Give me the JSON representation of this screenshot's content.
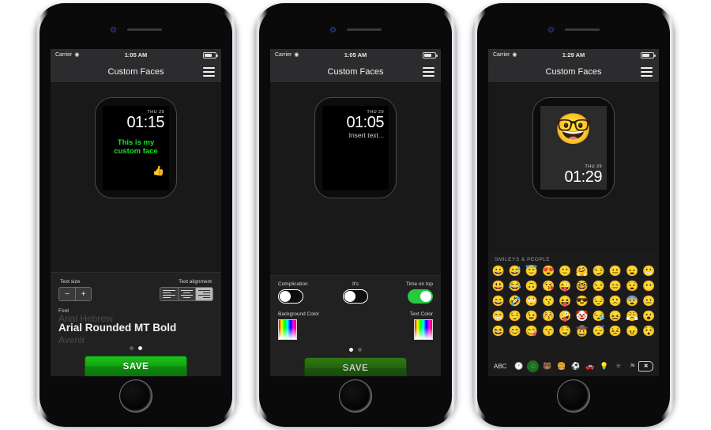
{
  "app": {
    "title": "Custom Faces"
  },
  "phones": [
    {
      "id": "phone-1",
      "status": {
        "carrier": "Carrier",
        "wifi_icon": "wifi-icon",
        "time": "1:05 AM",
        "battery_icon": "battery-icon"
      },
      "nav": {
        "title": "Custom Faces",
        "menu_icon": "hamburger-icon"
      },
      "watch": {
        "date": "THU 29",
        "time": "01:15",
        "custom_text": "This is my\ncustom face",
        "custom_text_line1": "This is my",
        "custom_text_line2": "custom face",
        "text_color": "#17e02a",
        "emoji": "👍"
      },
      "controls": {
        "text_size_label": "Text size",
        "text_alignment_label": "Text alignment",
        "minus_label": "−",
        "plus_label": "+",
        "alignment_options": [
          "align-left",
          "align-center",
          "align-right"
        ],
        "alignment_selected": "align-right",
        "font_caption": "Font",
        "font_prev": "Arial Hebrew",
        "font_selected": "Arial Rounded MT Bold",
        "font_next": "Avenir"
      },
      "page_dots": {
        "count": 2,
        "active": 1
      },
      "save_label": "SAVE",
      "save_enabled": true
    },
    {
      "id": "phone-2",
      "status": {
        "carrier": "Carrier",
        "wifi_icon": "wifi-icon",
        "time": "1:05 AM",
        "battery_icon": "battery-icon"
      },
      "nav": {
        "title": "Custom Faces",
        "menu_icon": "hamburger-icon"
      },
      "watch": {
        "date": "THU 29",
        "time": "01:05",
        "placeholder": "Insert text..."
      },
      "controls": {
        "switches": [
          {
            "label": "Complication",
            "on": false
          },
          {
            "label": "It's",
            "on": false
          },
          {
            "label": "Time on top",
            "on": true
          }
        ],
        "background_color_label": "Background Color",
        "text_color_label": "Text Color"
      },
      "page_dots": {
        "count": 2,
        "active": 0
      },
      "save_label": "SAVE",
      "save_enabled": false
    },
    {
      "id": "phone-3",
      "status": {
        "carrier": "Carrier",
        "wifi_icon": "wifi-icon",
        "time": "1:29 AM",
        "battery_icon": "battery-icon"
      },
      "nav": {
        "title": "Custom Faces",
        "menu_icon": "hamburger-icon"
      },
      "watch": {
        "date": "THU 29",
        "time": "01:29",
        "emoji": "🤓"
      },
      "keyboard": {
        "section_header": "SMILEYS & PEOPLE",
        "abc_label": "ABC",
        "delete_icon": "backspace-icon",
        "categories": [
          {
            "name": "recents-icon",
            "glyph": "🕐",
            "selected": false
          },
          {
            "name": "smileys-icon",
            "glyph": "☺",
            "selected": true
          },
          {
            "name": "animals-icon",
            "glyph": "🐻",
            "selected": false
          },
          {
            "name": "food-icon",
            "glyph": "🍔",
            "selected": false
          },
          {
            "name": "activity-icon",
            "glyph": "⚽",
            "selected": false
          },
          {
            "name": "travel-icon",
            "glyph": "🚗",
            "selected": false
          },
          {
            "name": "objects-icon",
            "glyph": "💡",
            "selected": false
          },
          {
            "name": "symbols-icon",
            "glyph": "✳",
            "selected": false
          },
          {
            "name": "flags-icon",
            "glyph": "⚑",
            "selected": false
          }
        ],
        "emoji_rows": [
          [
            "😀",
            "😅",
            "😇",
            "😍",
            "🙂",
            "🤗",
            "😏",
            "😐",
            "😦",
            "😬"
          ],
          [
            "😃",
            "😂",
            "🙃",
            "😘",
            "😜",
            "🤓",
            "😒",
            "😑",
            "😧",
            "😶"
          ],
          [
            "😄",
            "🤣",
            "🙄",
            "😗",
            "😝",
            "😎",
            "😔",
            "🙁",
            "😨",
            "😐"
          ],
          [
            "😁",
            "😌",
            "😉",
            "😚",
            "🤪",
            "🤡",
            "😪",
            "😖",
            "😤",
            "😮"
          ],
          [
            "😆",
            "😊",
            "😋",
            "😙",
            "🤤",
            "🤠",
            "😴",
            "😣",
            "😠",
            "😯"
          ]
        ]
      }
    }
  ]
}
